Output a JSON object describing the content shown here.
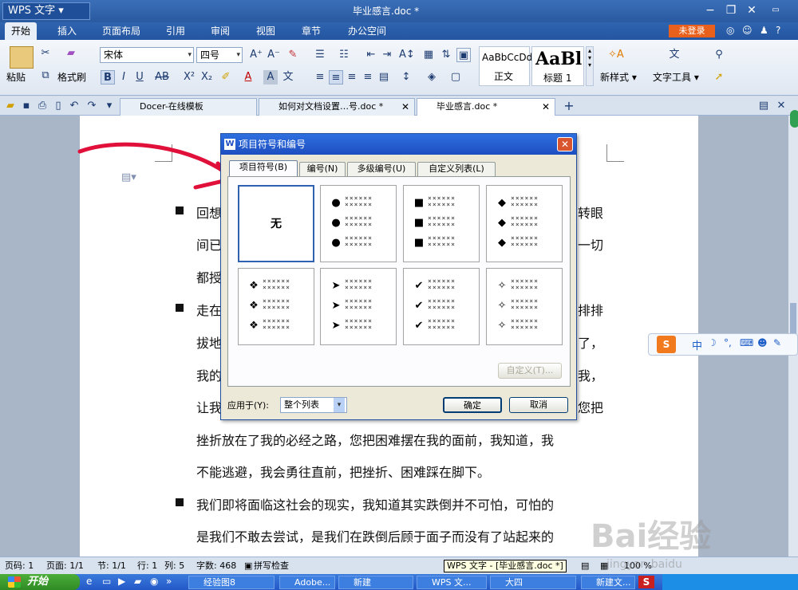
{
  "app": {
    "title": "WPS 文字",
    "doc_title": "毕业感言.doc *"
  },
  "ribbon_tabs": [
    "开始",
    "插入",
    "页面布局",
    "引用",
    "审阅",
    "视图",
    "章节",
    "办公空间"
  ],
  "login_label": "未登录",
  "ribbon": {
    "paste": "粘贴",
    "format_painter": "格式刷",
    "font_name": "宋体",
    "font_size": "四号",
    "style_normal_preview": "AaBbCcDd",
    "style_normal": "正文",
    "style_heading_preview": "AaBl",
    "style_heading": "标题 1",
    "new_style": "新样式",
    "text_tools": "文字工具"
  },
  "doc_tabs": [
    {
      "label": "Docer-在线模板",
      "active": false
    },
    {
      "label": "如何对文档设置…号.doc *",
      "active": false
    },
    {
      "label": "毕业感言.doc *",
      "active": true
    }
  ],
  "document": {
    "lines": [
      {
        "text": "回想",
        "bullet": true
      },
      {
        "text": "间已",
        "bullet": false
      },
      {
        "text": "都授",
        "bullet": false
      },
      {
        "text": "走在",
        "bullet": true
      },
      {
        "text": "拔地",
        "bullet": false
      },
      {
        "text": "我的",
        "bullet": false
      },
      {
        "text": "让我",
        "bullet": false
      },
      {
        "text": "挫折放在了我的必经之路，您把困难摆在我的面前，我知道，我",
        "bullet": false
      },
      {
        "text": "不能逃避，我会勇往直前，把挫折、困难踩在脚下。",
        "bullet": false
      },
      {
        "text": "我们即将面临这社会的现实，我知道其实跌倒并不可怕，可怕的",
        "bullet": true
      },
      {
        "text": "是我们不敢去尝试，是我们在跌倒后顾于面子而没有了站起来的",
        "bullet": false
      }
    ],
    "right_fragments": [
      "转眼",
      "一切",
      "排排",
      "了，",
      "我，",
      "您把"
    ]
  },
  "dialog": {
    "title": "项目符号和编号",
    "tabs": [
      "项目符号(B)",
      "编号(N)",
      "多级编号(U)",
      "自定义列表(L)"
    ],
    "none_label": "无",
    "bullet_symbols": [
      "●",
      "■",
      "◆",
      "❖",
      "➤",
      "✔",
      "✧"
    ],
    "placeholder_text": "××××××",
    "customize_label": "自定义(T)...",
    "apply_to_label": "应用于(Y):",
    "apply_to_value": "整个列表",
    "ok_label": "确定",
    "cancel_label": "取消"
  },
  "status": {
    "page_code": "页码: 1",
    "page": "页面: 1/1",
    "section": "节: 1/1",
    "row": "行: 1",
    "col": "列: 5",
    "words": "字数: 468",
    "spellcheck": "拼写检查",
    "tooltip": "WPS 文字 - [毕业感言.doc *]",
    "zoom": "100 %"
  },
  "taskbar": {
    "start": "开始",
    "items": [
      "经验图8",
      "Adobe...",
      "新建",
      "WPS 文...",
      "大四",
      "新建文..."
    ]
  },
  "watermark": {
    "brand": "Bai经验",
    "url": "jingyan.baidu"
  }
}
